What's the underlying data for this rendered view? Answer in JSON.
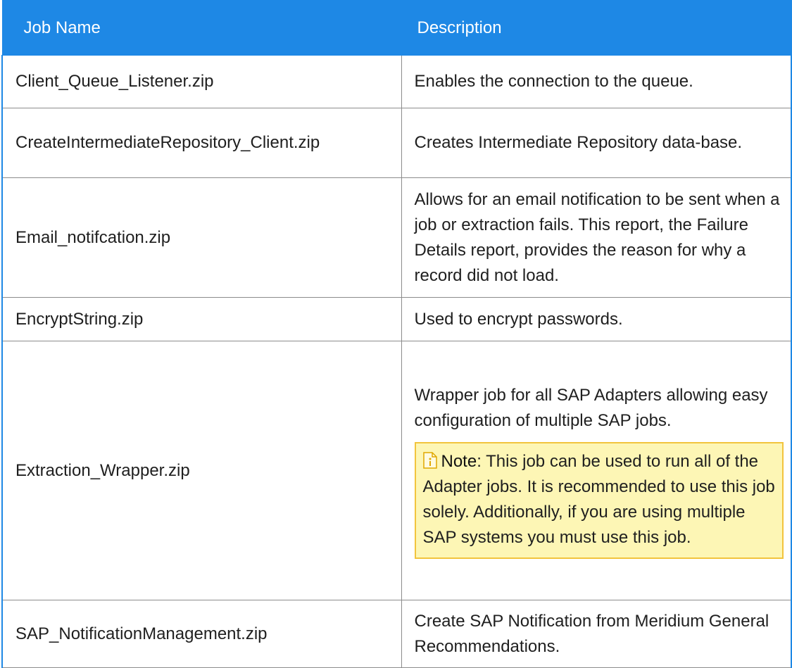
{
  "table": {
    "headers": {
      "job_name": "Job Name",
      "description": "Description"
    },
    "rows": [
      {
        "name": "Client_Queue_Listener.zip",
        "description": "Enables the connection to the queue."
      },
      {
        "name": "CreateIntermediateRepository_Client.zip",
        "description": "Creates Intermediate Repository data-base."
      },
      {
        "name": "Email_notifcation.zip",
        "description": "Allows for an email notification to be sent when a job or extraction fails. This report, the Failure Details report, provides the reason for why a record did not load."
      },
      {
        "name": "EncryptString.zip",
        "description": "Used to encrypt passwords."
      },
      {
        "name": "Extraction_Wrapper.zip",
        "description": "Wrapper job for all SAP Adapters allowing easy configuration of multiple SAP jobs.",
        "note": {
          "icon": "note-icon",
          "label": "Note",
          "separator": ":",
          "text": " This job can be used to run all of the Adapter jobs. It is recommended to use this job solely. Additionally, if you are using multiple SAP systems you must use this job."
        }
      },
      {
        "name": "SAP_NotificationManagement.zip",
        "description": "Create SAP Notification from Meridium General Recommendations."
      }
    ]
  },
  "colors": {
    "header_bg": "#1e88e5",
    "note_bg": "#fdf6b5",
    "note_border": "#f2c43d"
  }
}
